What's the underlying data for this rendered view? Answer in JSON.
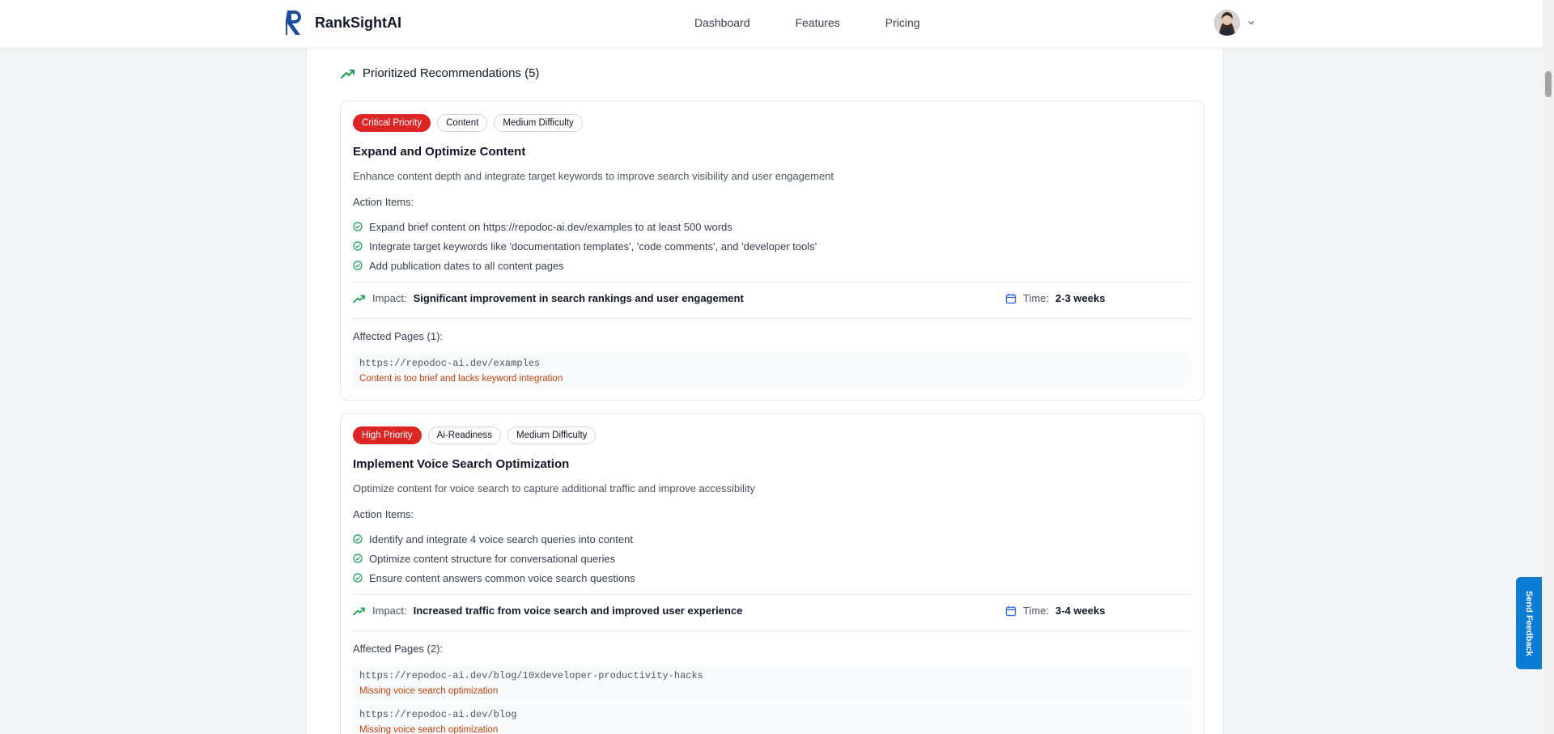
{
  "header": {
    "app_name": "RankSightAI",
    "nav": [
      "Dashboard",
      "Features",
      "Pricing"
    ]
  },
  "section": {
    "title": "Prioritized Recommendations (5)"
  },
  "recommendations": [
    {
      "badges": [
        "Critical Priority",
        "Content",
        "Medium Difficulty"
      ],
      "title": "Expand and Optimize Content",
      "description": "Enhance content depth and integrate target keywords to improve search visibility and user engagement",
      "action_items_label": "Action Items:",
      "action_items": [
        "Expand brief content on https://repodoc-ai.dev/examples to at least 500 words",
        "Integrate target keywords like 'documentation templates', 'code comments', and 'developer tools'",
        "Add publication dates to all content pages"
      ],
      "impact_label": "Impact:",
      "impact": "Significant improvement in search rankings and user engagement",
      "time_label": "Time:",
      "time": "2-3 weeks",
      "affected_label": "Affected Pages (1):",
      "affected_pages": [
        {
          "url": "https://repodoc-ai.dev/examples",
          "issue": "Content is too brief and lacks keyword integration"
        }
      ]
    },
    {
      "badges": [
        "High Priority",
        "Ai-Readiness",
        "Medium Difficulty"
      ],
      "title": "Implement Voice Search Optimization",
      "description": "Optimize content for voice search to capture additional traffic and improve accessibility",
      "action_items_label": "Action Items:",
      "action_items": [
        "Identify and integrate 4 voice search queries into content",
        "Optimize content structure for conversational queries",
        "Ensure content answers common voice search questions"
      ],
      "impact_label": "Impact:",
      "impact": "Increased traffic from voice search and improved user experience",
      "time_label": "Time:",
      "time": "3-4 weeks",
      "affected_label": "Affected Pages (2):",
      "affected_pages": [
        {
          "url": "https://repodoc-ai.dev/blog/10xdeveloper-productivity-hacks",
          "issue": "Missing voice search optimization"
        },
        {
          "url": "https://repodoc-ai.dev/blog",
          "issue": "Missing voice search optimization"
        }
      ]
    }
  ],
  "feedback": {
    "label": "Send Feedback"
  },
  "colors": {
    "brand": "#1f4e9c",
    "critical": "#dc2626",
    "success": "#16a34a",
    "issue": "#c2410c",
    "feedback_button": "#0c7bd4"
  },
  "icons": [
    "logo-mark",
    "trending-up-icon",
    "check-circle-icon",
    "calendar-icon",
    "chevron-down-icon",
    "avatar"
  ]
}
